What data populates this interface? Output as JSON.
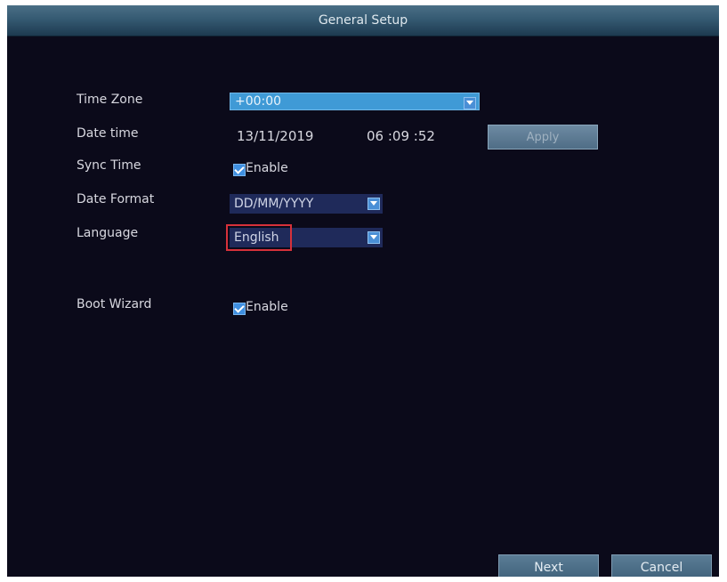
{
  "window": {
    "title": "General Setup"
  },
  "fields": {
    "time_zone": {
      "label": "Time Zone",
      "value": "+00:00"
    },
    "date_time": {
      "label": "Date time",
      "date": "13/11/2019",
      "time": "06 :09 :52",
      "apply_label": "Apply"
    },
    "sync_time": {
      "label": "Sync Time",
      "checked": true,
      "option_label": "Enable"
    },
    "date_format": {
      "label": "Date Format",
      "value": "DD/MM/YYYY"
    },
    "language": {
      "label": "Language",
      "value": "English"
    },
    "boot_wizard": {
      "label": "Boot Wizard",
      "checked": true,
      "option_label": "Enable"
    }
  },
  "footer": {
    "next_label": "Next",
    "cancel_label": "Cancel"
  },
  "icons": {
    "dropdown": "chevron-down-icon",
    "checkbox": "checkbox-checked-icon"
  },
  "colors": {
    "background": "#0b0a1a",
    "titlebar": "#355a72",
    "accent": "#3f9ad6",
    "highlight": "#d6313a"
  }
}
